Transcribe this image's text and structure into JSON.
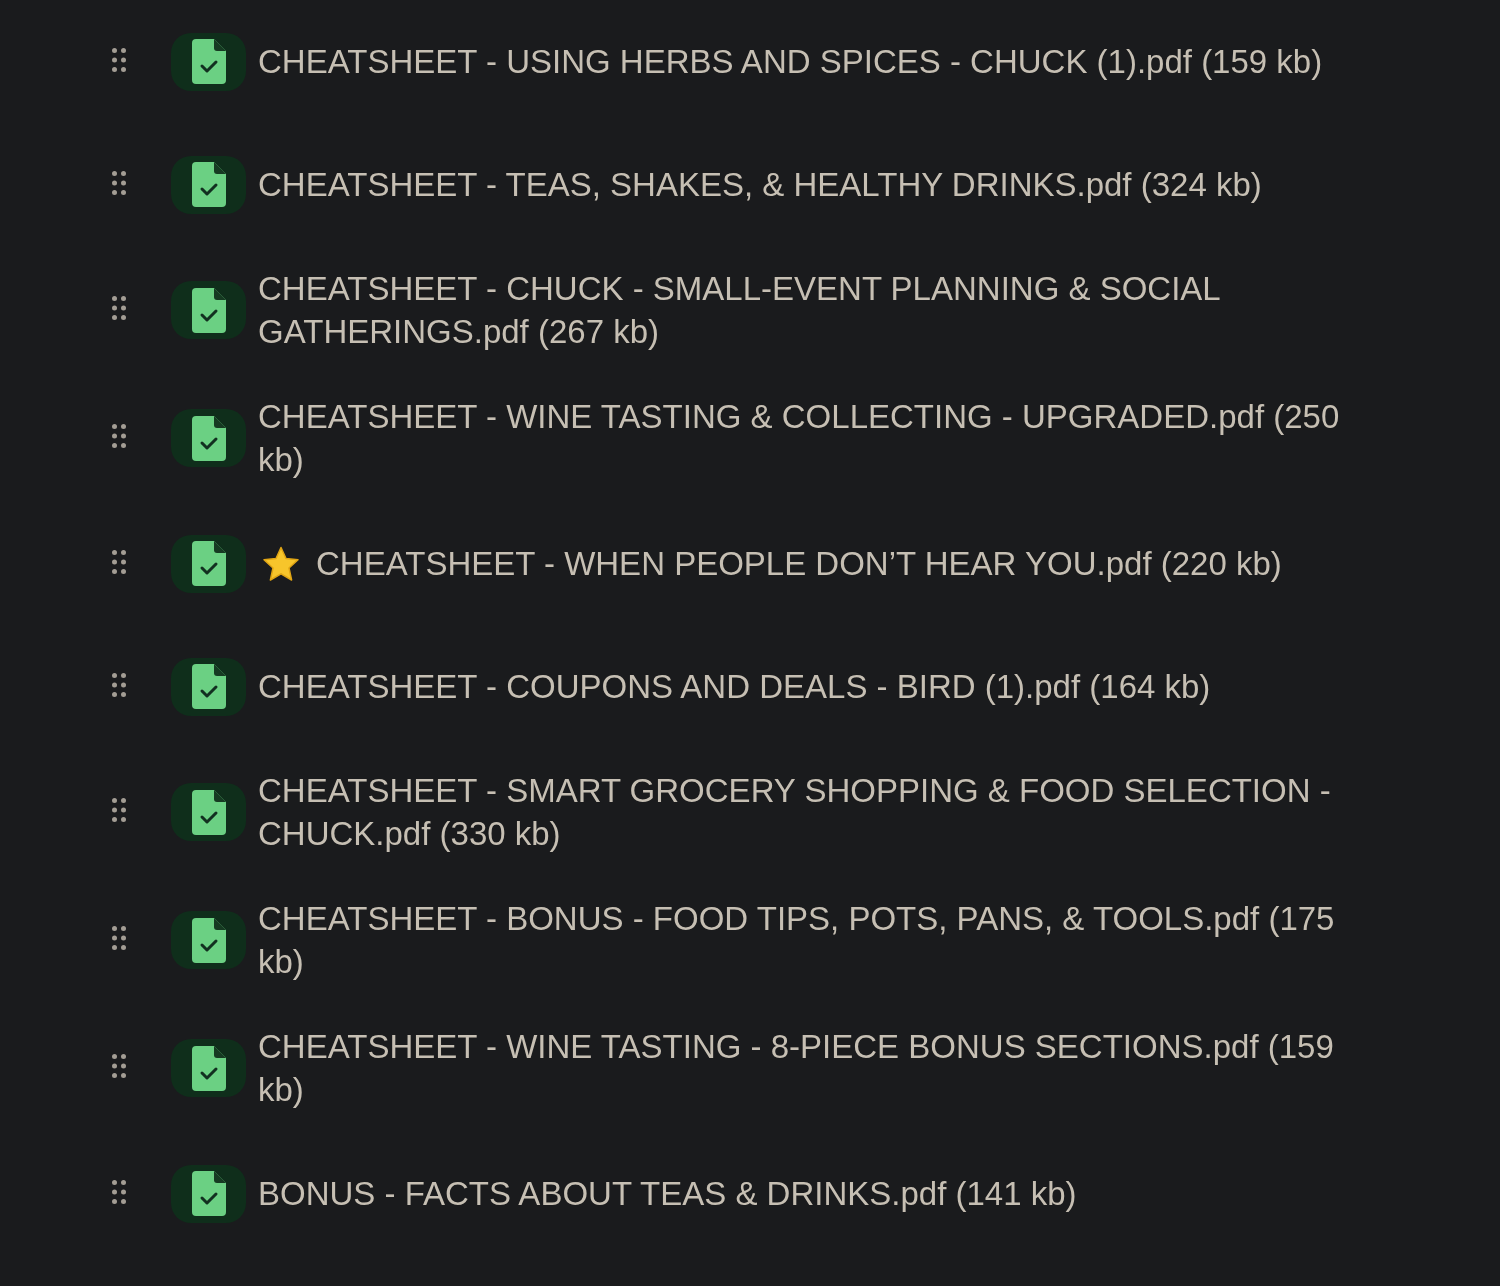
{
  "files": [
    {
      "name": "CHEATSHEET - USING HERBS AND SPICES - CHUCK (1).pdf (159 kb)",
      "starred": false
    },
    {
      "name": "CHEATSHEET - TEAS, SHAKES, & HEALTHY DRINKS.pdf (324 kb)",
      "starred": false
    },
    {
      "name": "CHEATSHEET - CHUCK - SMALL-EVENT PLANNING & SOCIAL GATHERINGS.pdf (267 kb)",
      "starred": false
    },
    {
      "name": "CHEATSHEET - WINE TASTING & COLLECTING - UPGRADED.pdf (250 kb)",
      "starred": false
    },
    {
      "name": "CHEATSHEET - WHEN PEOPLE DON’T HEAR YOU.pdf (220 kb)",
      "starred": true
    },
    {
      "name": "CHEATSHEET - COUPONS AND DEALS - BIRD (1).pdf (164 kb)",
      "starred": false
    },
    {
      "name": "CHEATSHEET - SMART GROCERY SHOPPING & FOOD SELECTION - CHUCK.pdf (330 kb)",
      "starred": false
    },
    {
      "name": "CHEATSHEET - BONUS - FOOD TIPS, POTS, PANS, & TOOLS.pdf (175 kb)",
      "starred": false
    },
    {
      "name": "CHEATSHEET - WINE TASTING - 8-PIECE BONUS SECTIONS.pdf (159 kb)",
      "starred": false
    },
    {
      "name": "BONUS - FACTS ABOUT TEAS & DRINKS.pdf (141 kb)",
      "starred": false
    }
  ]
}
